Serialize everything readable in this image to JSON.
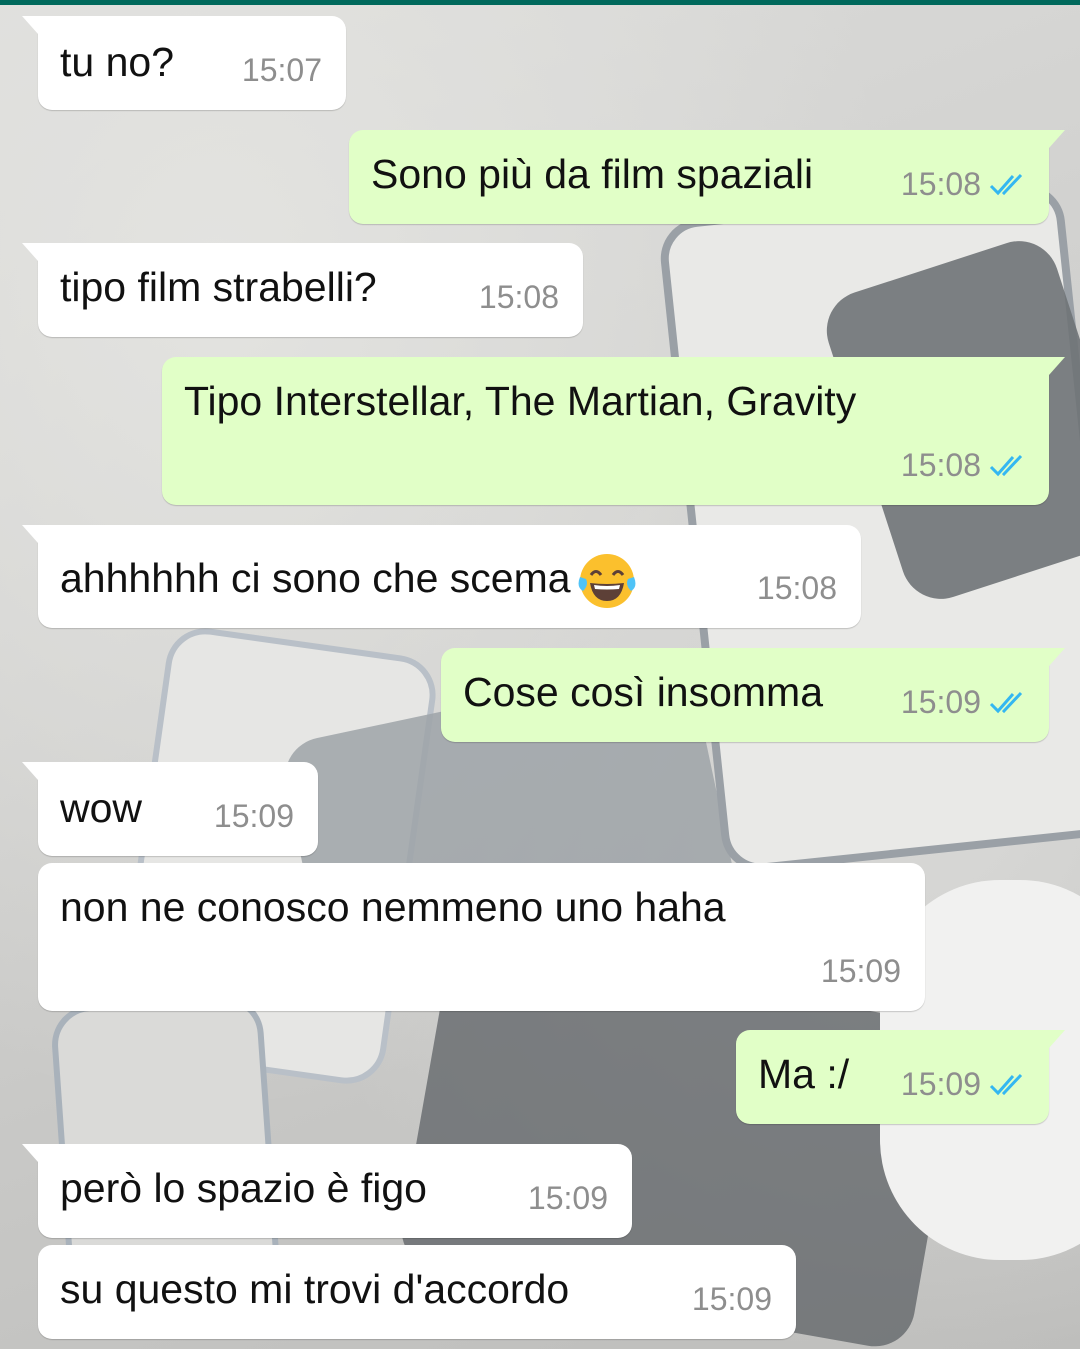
{
  "theme": {
    "incoming_bg": "#ffffff",
    "outgoing_bg": "#e1ffc7",
    "time_color": "#8e8e8e",
    "read_ticks_color": "#34b7f1"
  },
  "messages": [
    {
      "dir": "in",
      "text": "tu no?",
      "time": "15:07"
    },
    {
      "dir": "out",
      "text": "Sono più da film spaziali",
      "time": "15:08",
      "status": "read"
    },
    {
      "dir": "in",
      "text": "tipo film strabelli?",
      "time": "15:08"
    },
    {
      "dir": "out",
      "text": "Tipo Interstellar, The Martian, Gravity",
      "time": "15:08",
      "status": "read"
    },
    {
      "dir": "in",
      "text": "ahhhhhh ci sono che scema",
      "emoji": "face-with-tears-of-joy",
      "time": "15:08"
    },
    {
      "dir": "out",
      "text": "Cose così insomma",
      "time": "15:09",
      "status": "read"
    },
    {
      "dir": "in",
      "text": "wow",
      "time": "15:09"
    },
    {
      "dir": "in",
      "text": "non ne conosco nemmeno uno haha",
      "time": "15:09"
    },
    {
      "dir": "out",
      "text": "Ma :/",
      "time": "15:09",
      "status": "read"
    },
    {
      "dir": "in",
      "text": "però lo spazio è figo",
      "time": "15:09"
    },
    {
      "dir": "in",
      "text": "su questo mi trovi d'accordo",
      "time": "15:09"
    }
  ]
}
